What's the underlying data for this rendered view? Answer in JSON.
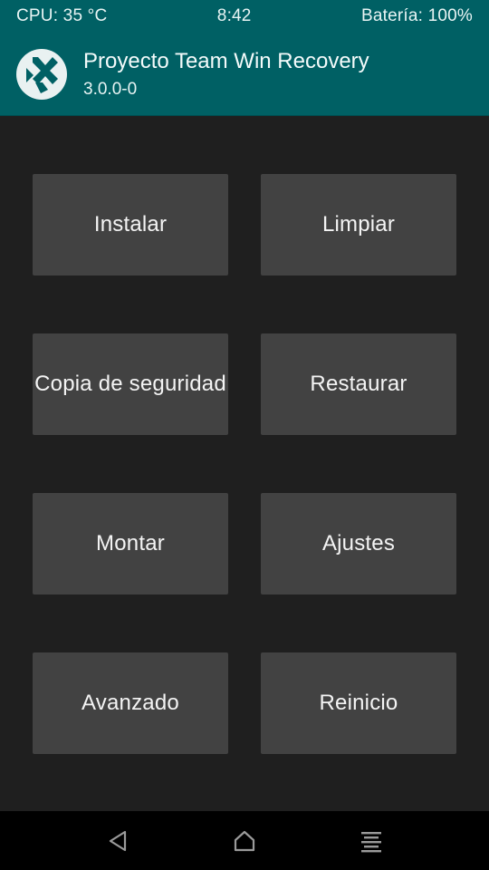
{
  "status_bar": {
    "cpu": "CPU: 35 °C",
    "time": "8:42",
    "battery": "Batería: 100%"
  },
  "header": {
    "title": "Proyecto Team Win Recovery",
    "version": "3.0.0-0",
    "logo_icon": "twrp-logo-icon"
  },
  "menu": {
    "install": "Instalar",
    "wipe": "Limpiar",
    "backup": "Copia de seguridad",
    "restore": "Restaurar",
    "mount": "Montar",
    "settings": "Ajustes",
    "advanced": "Avanzado",
    "reboot": "Reinicio"
  },
  "nav_bar": {
    "back_icon": "back-icon",
    "home_icon": "home-icon",
    "menu_icon": "console-menu-icon"
  },
  "colors": {
    "accent": "#006064",
    "background": "#1f1f1f",
    "button": "#424242",
    "nav_bar": "#000000"
  }
}
